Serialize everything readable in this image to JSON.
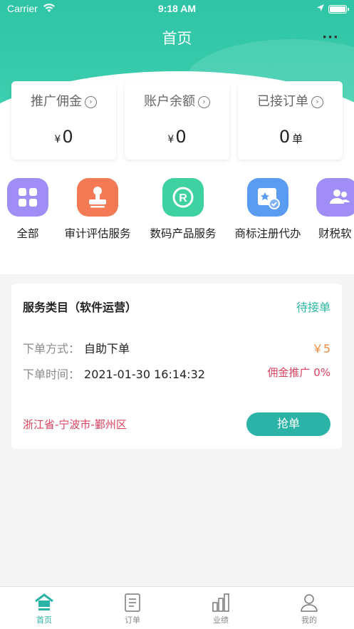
{
  "status_bar": {
    "carrier": "Carrier",
    "time": "9:18 AM"
  },
  "nav": {
    "title": "首页",
    "more": "···"
  },
  "stats": [
    {
      "label": "推广佣金",
      "currency": "¥",
      "value": "0",
      "unit": ""
    },
    {
      "label": "账户余额",
      "currency": "¥",
      "value": "0",
      "unit": ""
    },
    {
      "label": "已接订单",
      "currency": "",
      "value": "0",
      "unit": "单"
    }
  ],
  "categories": [
    {
      "label": "全部",
      "icon": "grid-icon",
      "color": "#a08df5"
    },
    {
      "label": "审计评估服务",
      "icon": "stamp-icon",
      "color": "#f47a56"
    },
    {
      "label": "数码产品服务",
      "icon": "registered-icon",
      "color": "#3ed2a2"
    },
    {
      "label": "商标注册代办",
      "icon": "trademark-icon",
      "color": "#5a9cf2"
    },
    {
      "label": "财税软",
      "icon": "users-icon",
      "color": "#a08df5"
    }
  ],
  "order": {
    "title": "服务类目（软件运营）",
    "status": "待接单",
    "method_label": "下单方式：",
    "method_value": "自助下单",
    "time_label": "下单时间：",
    "time_value": "2021-01-30 16:14:32",
    "price": "￥5",
    "commission": "佣金推广 0%",
    "address": "浙江省-宁波市-鄞州区",
    "action": "抢单"
  },
  "tabbar": [
    {
      "label": "首页",
      "icon": "home-icon",
      "active": true
    },
    {
      "label": "订单",
      "icon": "order-icon",
      "active": false
    },
    {
      "label": "业绩",
      "icon": "chart-icon",
      "active": false
    },
    {
      "label": "我的",
      "icon": "profile-icon",
      "active": false
    }
  ],
  "colors": {
    "accent": "#2bb3a8",
    "header": "#2ec4a5",
    "warning": "#f08a3c",
    "danger": "#d9435f"
  }
}
